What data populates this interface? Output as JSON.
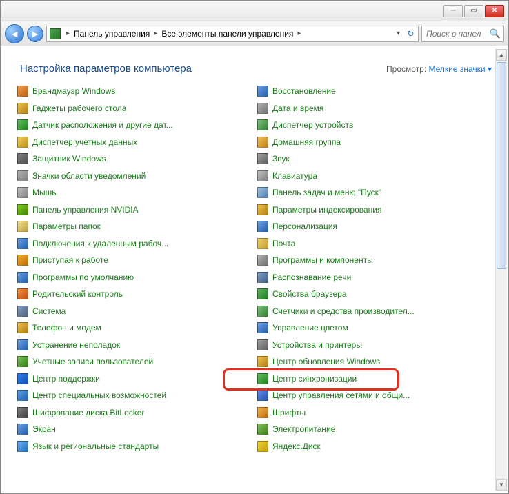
{
  "breadcrumbs": [
    "Панель управления",
    "Все элементы панели управления"
  ],
  "search": {
    "placeholder": "Поиск в панел"
  },
  "header": {
    "title": "Настройка параметров компьютера",
    "view_label": "Просмотр:",
    "view_value": "Мелкие значки"
  },
  "items_left": [
    "Брандмауэр Windows",
    "Гаджеты рабочего стола",
    "Датчик расположения и другие дат...",
    "Диспетчер учетных данных",
    "Защитник Windows",
    "Значки области уведомлений",
    "Мышь",
    "Панель управления NVIDIA",
    "Параметры папок",
    "Подключения к удаленным рабоч...",
    "Приступая к работе",
    "Программы по умолчанию",
    "Родительский контроль",
    "Система",
    "Телефон и модем",
    "Устранение неполадок",
    "Учетные записи пользователей",
    "Центр поддержки",
    "Центр специальных возможностей",
    "Шифрование диска BitLocker",
    "Экран",
    "Язык и региональные стандарты"
  ],
  "items_right": [
    "Восстановление",
    "Дата и время",
    "Диспетчер устройств",
    "Домашняя группа",
    "Звук",
    "Клавиатура",
    "Панель задач и меню \"Пуск\"",
    "Параметры индексирования",
    "Персонализация",
    "Почта",
    "Программы и компоненты",
    "Распознавание речи",
    "Свойства браузера",
    "Счетчики и средства производител...",
    "Управление цветом",
    "Устройства и принтеры",
    "Центр обновления Windows",
    "Центр синхронизации",
    "Центр управления сетями и общи...",
    "Шрифты",
    "Электропитание",
    "Яндекс.Диск"
  ],
  "highlighted_index_right": 18,
  "icon_colors_left": [
    "linear-gradient(135deg,#f0a050,#c06010)",
    "linear-gradient(135deg,#f0c050,#b08010)",
    "linear-gradient(135deg,#60c060,#208020)",
    "linear-gradient(135deg,#f0d060,#c09010)",
    "linear-gradient(135deg,#808080,#505050)",
    "linear-gradient(135deg,#b0b0b0,#808080)",
    "linear-gradient(135deg,#c0c0c0,#808080)",
    "linear-gradient(135deg,#80d020,#408000)",
    "linear-gradient(135deg,#f0e090,#c0a040)",
    "linear-gradient(135deg,#70a0e0,#2060b0)",
    "linear-gradient(135deg,#f0b030,#c07000)",
    "linear-gradient(135deg,#70a0e0,#2060b0)",
    "linear-gradient(135deg,#f09040,#c05010)",
    "linear-gradient(135deg,#80a0c0,#506080)",
    "linear-gradient(135deg,#f0c050,#b08010)",
    "linear-gradient(135deg,#70a0e0,#2060b0)",
    "linear-gradient(135deg,#80c060,#308010)",
    "linear-gradient(135deg,#3080f0,#1050b0)",
    "linear-gradient(135deg,#60a0e0,#2060b0)",
    "linear-gradient(135deg,#808080,#404040)",
    "linear-gradient(135deg,#70a0e0,#2060b0)",
    "linear-gradient(135deg,#70b0f0,#2070c0)"
  ],
  "icon_colors_right": [
    "linear-gradient(135deg,#70a0e0,#2060b0)",
    "linear-gradient(135deg,#b0b0b0,#707070)",
    "linear-gradient(135deg,#80c080,#308030)",
    "linear-gradient(135deg,#f0c060,#c08010)",
    "linear-gradient(135deg,#a0a0a0,#606060)",
    "linear-gradient(135deg,#c0c0c0,#808080)",
    "linear-gradient(135deg,#a0c0e0,#5080b0)",
    "linear-gradient(135deg,#f0c050,#b08010)",
    "linear-gradient(135deg,#70a0e0,#2060b0)",
    "linear-gradient(135deg,#f0d070,#c0a030)",
    "linear-gradient(135deg,#b0b0b0,#707070)",
    "linear-gradient(135deg,#80a0c0,#406090)",
    "linear-gradient(135deg,#60b060,#208020)",
    "linear-gradient(135deg,#80c080,#308030)",
    "linear-gradient(135deg,#70a0e0,#2060b0)",
    "linear-gradient(135deg,#a0a0a0,#606060)",
    "linear-gradient(135deg,#f0c050,#b08010)",
    "linear-gradient(135deg,#60c060,#208020)",
    "linear-gradient(135deg,#6090e0,#2050b0)",
    "linear-gradient(135deg,#f0b050,#c07010)",
    "linear-gradient(135deg,#80c060,#408010)",
    "linear-gradient(135deg,#f0d040,#c0a000)"
  ]
}
